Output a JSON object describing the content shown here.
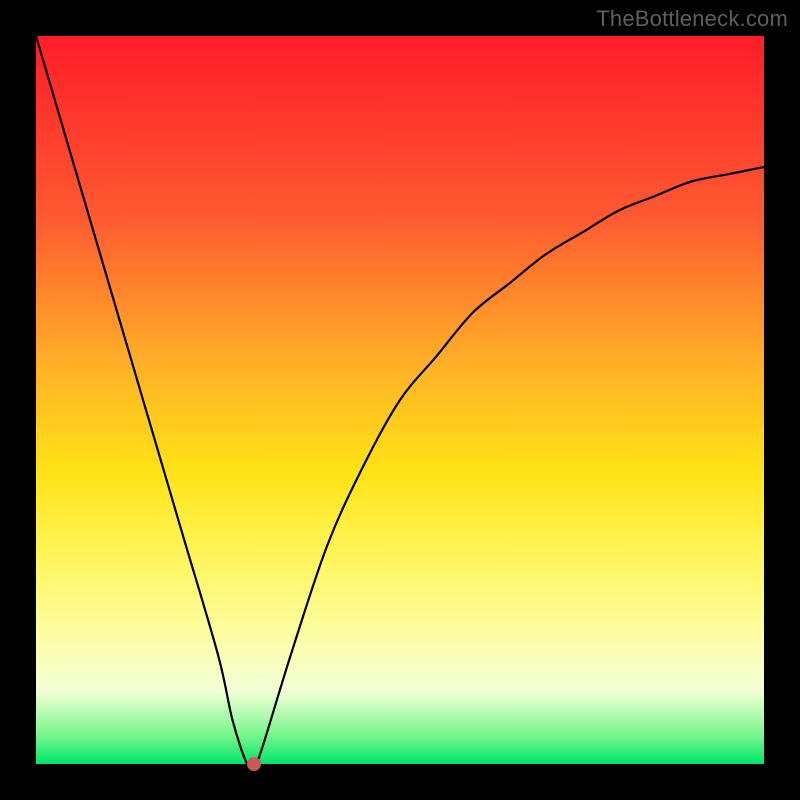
{
  "watermark": "TheBottleneck.com",
  "chart_data": {
    "type": "line",
    "title": "",
    "xlabel": "",
    "ylabel": "",
    "xlim": [
      0,
      100
    ],
    "ylim": [
      0,
      100
    ],
    "grid": false,
    "legend": false,
    "series": [
      {
        "name": "curve",
        "x": [
          0,
          5,
          10,
          15,
          20,
          25,
          27,
          29,
          30,
          31,
          35,
          40,
          45,
          50,
          55,
          60,
          65,
          70,
          75,
          80,
          85,
          90,
          95,
          100
        ],
        "values": [
          100,
          83,
          66,
          49,
          32,
          15,
          6,
          0,
          0,
          2,
          15,
          30,
          41,
          50,
          56,
          62,
          66,
          70,
          73,
          76,
          78,
          80,
          81,
          82
        ]
      }
    ],
    "annotations": [
      {
        "name": "marker-dot",
        "x": 30,
        "y": 0
      }
    ],
    "background_gradient": {
      "top": "#ff1c2a",
      "mid1": "#ffb027",
      "mid2": "#ffe315",
      "mid3": "#fcffaf",
      "bottom": "#00e56a"
    }
  }
}
